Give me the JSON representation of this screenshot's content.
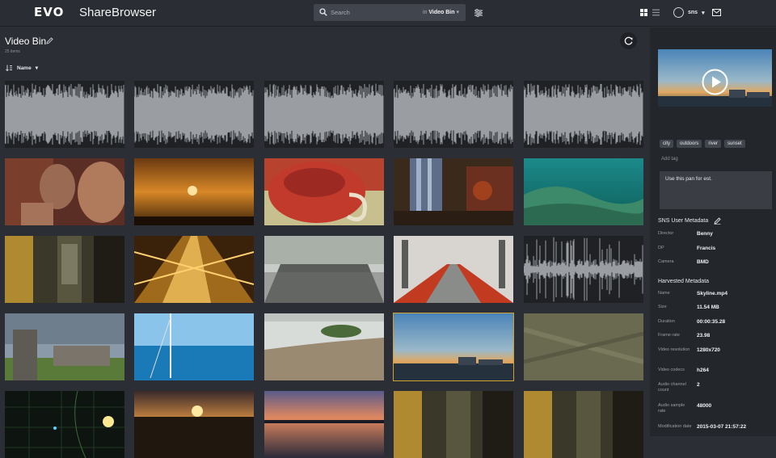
{
  "header": {
    "logo_text": "EVO",
    "app_name": "ShareBrowser",
    "search": {
      "placeholder": "Search",
      "scope_prefix": "in",
      "scope_value": "Video Bin"
    },
    "user": {
      "name": "sns"
    }
  },
  "main": {
    "title": "Video Bin",
    "item_count": "25 items",
    "sort_label": "Name"
  },
  "sidebar": {
    "tags": [
      "city",
      "outdoors",
      "river",
      "sunset"
    ],
    "add_tag": "Add tag",
    "note": "Use this pan for est.",
    "user_meta_title": "SNS User Metadata",
    "user_meta": [
      {
        "key": "Director",
        "value": "Benny"
      },
      {
        "key": "DP",
        "value": "Francis"
      },
      {
        "key": "Camera",
        "value": "BMD"
      }
    ],
    "harvested_title": "Harvested Metadata",
    "harvested": [
      {
        "key": "Name",
        "value": "Skyline.mp4"
      },
      {
        "key": "Size",
        "value": "11.54 MB"
      },
      {
        "key": "Duration",
        "value": "00:00:35.28"
      },
      {
        "key": "Frame rate",
        "value": "23.98"
      },
      {
        "key": "Video resolution",
        "value": "1280x720"
      },
      {
        "key": "Video codecs",
        "value": "h264"
      },
      {
        "key": "Audio channel count",
        "value": "2"
      },
      {
        "key": "Audio sample rate",
        "value": "48000"
      },
      {
        "key": "Modification date",
        "value": "2015-03-07 21:57:22"
      }
    ]
  },
  "colors": {
    "accent_selection": "#d0a22f",
    "background": "#2b2e35",
    "sidebar": "#23262b"
  }
}
